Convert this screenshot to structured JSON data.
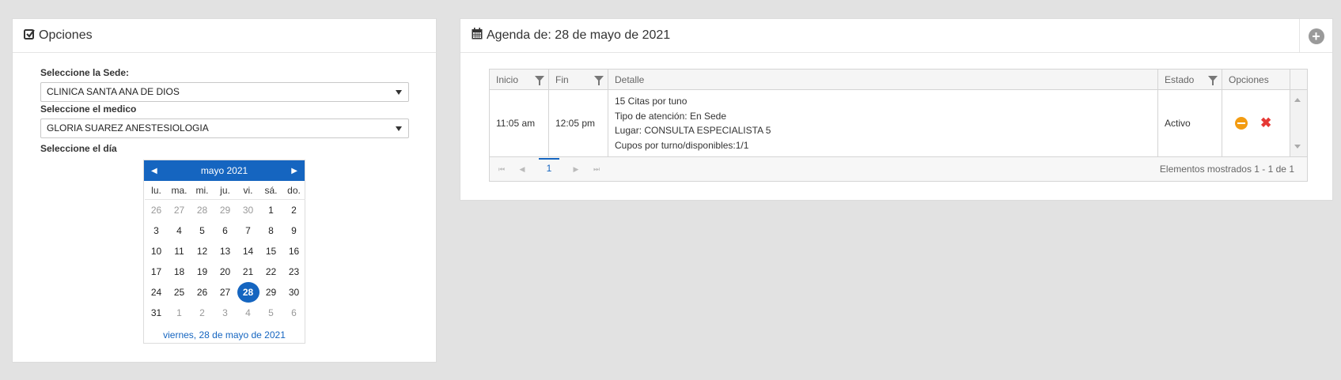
{
  "left_panel": {
    "title": "Opciones",
    "sede_label": "Seleccione la Sede:",
    "sede_value": "CLINICA SANTA ANA DE DIOS",
    "medico_label": "Seleccione el medico",
    "medico_value": "GLORIA SUAREZ ANESTESIOLOGIA",
    "dia_label": "Seleccione el día"
  },
  "calendar": {
    "month_label": "mayo 2021",
    "prev": "◀",
    "next": "▶",
    "weekdays": [
      "lu.",
      "ma.",
      "mi.",
      "ju.",
      "vi.",
      "sá.",
      "do."
    ],
    "weeks": [
      [
        "26",
        "27",
        "28",
        "29",
        "30",
        "1",
        "2"
      ],
      [
        "3",
        "4",
        "5",
        "6",
        "7",
        "8",
        "9"
      ],
      [
        "10",
        "11",
        "12",
        "13",
        "14",
        "15",
        "16"
      ],
      [
        "17",
        "18",
        "19",
        "20",
        "21",
        "22",
        "23"
      ],
      [
        "24",
        "25",
        "26",
        "27",
        "28",
        "29",
        "30"
      ],
      [
        "31",
        "1",
        "2",
        "3",
        "4",
        "5",
        "6"
      ]
    ],
    "selected_day": "28",
    "footer": "viernes, 28 de mayo de 2021"
  },
  "right_panel": {
    "title": "Agenda de: 28 de mayo de 2021",
    "add_icon": "+"
  },
  "grid": {
    "headers": {
      "inicio": "Inicio",
      "fin": "Fin",
      "detalle": "Detalle",
      "estado": "Estado",
      "opciones": "Opciones"
    },
    "row": {
      "inicio": "11:05 am",
      "fin": "12:05 pm",
      "detalle_1": "15 Citas por tuno",
      "detalle_2": "Tipo de atención: En Sede",
      "detalle_3": "Lugar: CONSULTA ESPECIALISTA 5",
      "detalle_4": "Cupos por turno/disponibles:1/1",
      "estado": "Activo",
      "remove_icon": "✖"
    },
    "pager": {
      "first": "⏮",
      "prev": "◀",
      "page": "1",
      "next": "▶",
      "last": "⏭",
      "info": "Elementos mostrados 1 - 1 de 1"
    }
  }
}
